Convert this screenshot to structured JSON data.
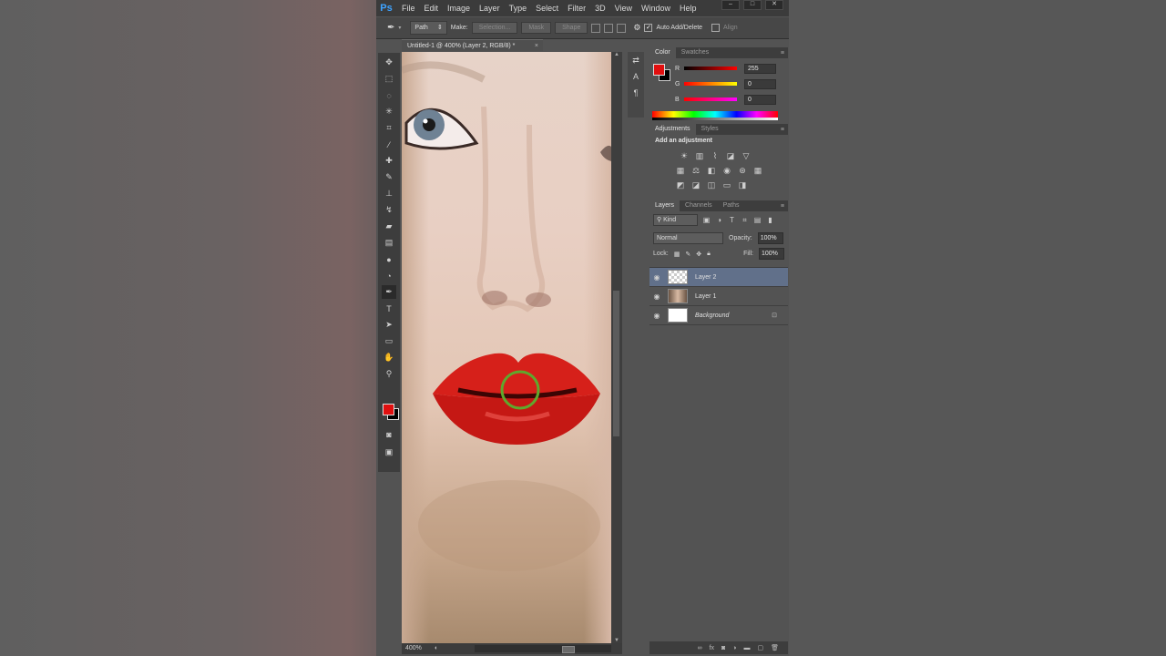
{
  "menu": {
    "logo": "Ps",
    "items": [
      "File",
      "Edit",
      "Image",
      "Layer",
      "Type",
      "Select",
      "Filter",
      "3D",
      "View",
      "Window",
      "Help"
    ]
  },
  "options": {
    "mode": "Path",
    "make_label": "Make:",
    "selection": "Selection...",
    "mask": "Mask",
    "shape": "Shape",
    "auto_add_delete": "Auto Add/Delete",
    "align": "Align"
  },
  "document": {
    "tab_title": "Untitled-1 @ 400% (Layer 2, RGB/8) *",
    "zoom": "400%"
  },
  "color_panel": {
    "tabs": [
      "Color",
      "Swatches"
    ],
    "r_label": "R",
    "r_value": "255",
    "g_label": "G",
    "g_value": "0",
    "b_label": "B",
    "b_value": "0",
    "foreground": "#e20f0f",
    "background": "#000000"
  },
  "adjustments_panel": {
    "tabs": [
      "Adjustments",
      "Styles"
    ],
    "title": "Add an adjustment"
  },
  "layers_panel": {
    "tabs": [
      "Layers",
      "Channels",
      "Paths"
    ],
    "filter_kind": "Kind",
    "blend_mode": "Normal",
    "opacity_label": "Opacity:",
    "opacity_value": "100%",
    "lock_label": "Lock:",
    "fill_label": "Fill:",
    "fill_value": "100%",
    "layers": [
      {
        "name": "Layer 2",
        "selected": true
      },
      {
        "name": "Layer 1",
        "selected": false
      },
      {
        "name": "Background",
        "selected": false,
        "locked": true
      }
    ]
  }
}
